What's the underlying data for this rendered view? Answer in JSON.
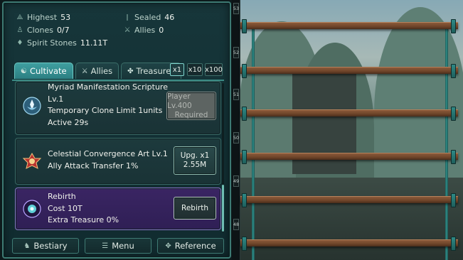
{
  "stats": {
    "highest_label": "Highest",
    "highest_value": "53",
    "sealed_label": "Sealed",
    "sealed_value": "46",
    "clones_label": "Clones",
    "clones_value": "0/7",
    "allies_label": "Allies",
    "allies_value": "0",
    "spirit_label": "Spirit Stones",
    "spirit_value": "11.11T"
  },
  "tabs": [
    {
      "label": "Cultivate",
      "icon": "cultivate-icon",
      "active": true
    },
    {
      "label": "Allies",
      "icon": "allies-icon",
      "active": false
    },
    {
      "label": "Treasures",
      "icon": "treasure-icon",
      "active": false
    }
  ],
  "multipliers": [
    "x1",
    "x10",
    "x100"
  ],
  "cards": [
    {
      "lines": [
        "Myriad Manifestation Scripture",
        "Lv.1",
        "Temporary Clone Limit 1units",
        "Active 29s"
      ],
      "button": [
        "Player Lv.400",
        "Required"
      ],
      "icon": "scripture-lotus-icon"
    },
    {
      "lines": [
        "Celestial Convergence Art Lv.1",
        "Ally Attack Transfer 1%"
      ],
      "button": [
        "Upg. x1",
        "2.55M"
      ],
      "icon": "convergence-art-icon"
    },
    {
      "lines": [
        "Rebirth",
        "Cost 10T",
        "Extra Treasure 0%"
      ],
      "button": [
        "Rebirth"
      ],
      "icon": "rebirth-orb-icon"
    }
  ],
  "bottom": {
    "bestiary": "Bestiary",
    "menu": "Menu",
    "reference": "Reference"
  },
  "floors": [
    "53",
    "52",
    "51",
    "50",
    "49",
    "48"
  ],
  "colors": {
    "panel": "#17363a",
    "accent": "#3f9fa0",
    "rebirth_card": "#3a2563",
    "shelf": "#8b5a3a"
  }
}
